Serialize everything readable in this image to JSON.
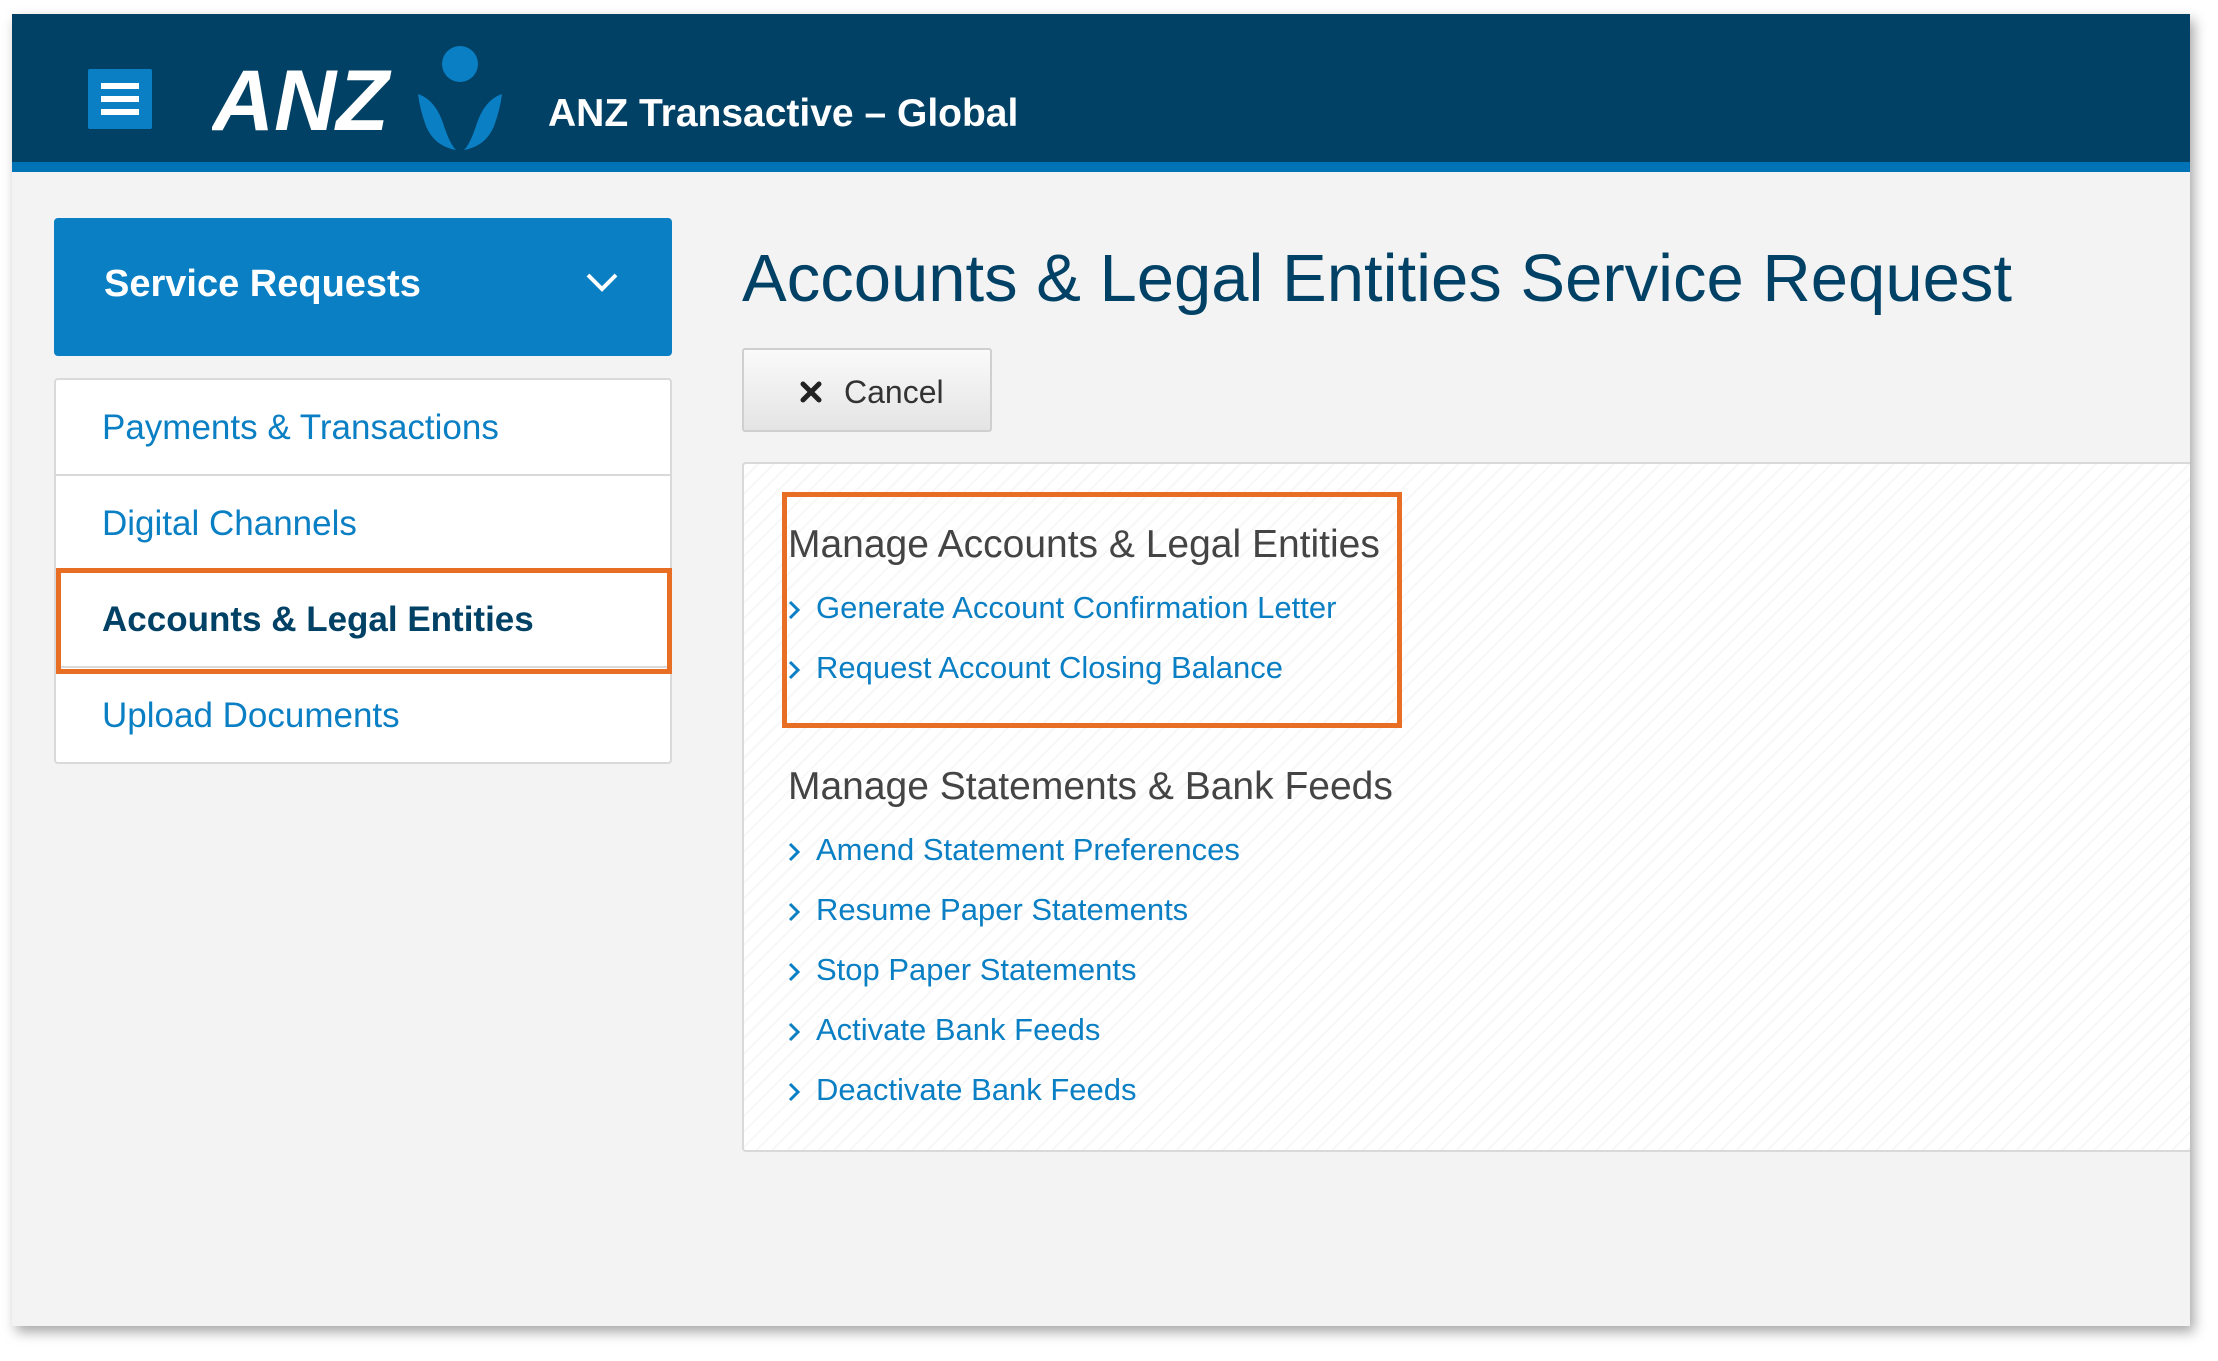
{
  "header": {
    "logo_text": "ANZ",
    "app_title": "ANZ Transactive – Global"
  },
  "sidebar": {
    "title": "Service Requests",
    "items": [
      {
        "label": "Payments & Transactions",
        "active": false
      },
      {
        "label": "Digital Channels",
        "active": false
      },
      {
        "label": "Accounts & Legal Entities",
        "active": true
      },
      {
        "label": "Upload Documents",
        "active": false
      }
    ]
  },
  "main": {
    "page_title": "Accounts & Legal Entities Service Request",
    "cancel_label": "Cancel",
    "sections": [
      {
        "title": "Manage Accounts & Legal Entities",
        "links": [
          "Generate Account Confirmation Letter",
          "Request Account Closing Balance"
        ]
      },
      {
        "title": "Manage Statements & Bank Feeds",
        "links": [
          "Amend Statement Preferences",
          "Resume Paper Statements",
          "Stop Paper Statements",
          "Activate Bank Feeds",
          "Deactivate Bank Feeds"
        ]
      }
    ]
  },
  "colors": {
    "header_bg": "#004165",
    "accent_blue": "#0a7fc4",
    "highlight_orange": "#e86e23"
  }
}
